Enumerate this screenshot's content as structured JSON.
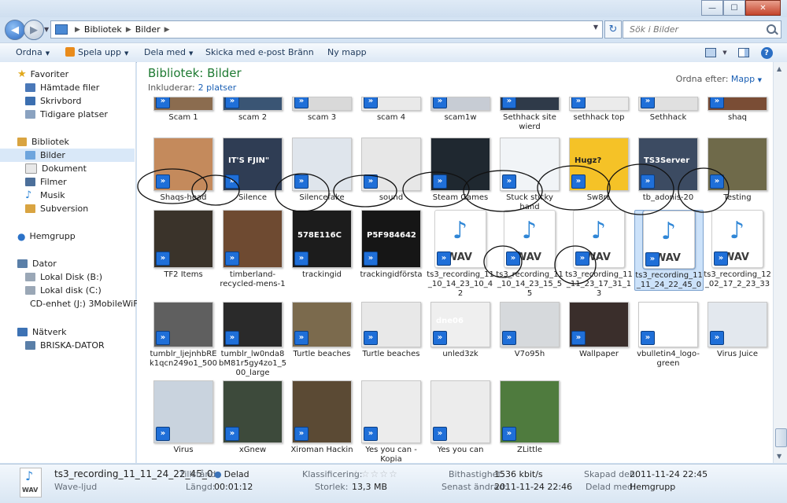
{
  "window": {
    "minimize": "—",
    "maximize": "☐",
    "close": "✕"
  },
  "address": {
    "crumbs": [
      "Bibliotek",
      "Bilder"
    ],
    "search_placeholder": "Sök i Bilder"
  },
  "toolbar": {
    "organize": "Ordna",
    "play": "Spela upp",
    "share": "Dela med",
    "email": "Skicka med e-post",
    "burn": "Bränn",
    "new_folder": "Ny mapp",
    "help": "?"
  },
  "sidebar": {
    "favorites": "Favoriter",
    "fav_items": [
      "Hämtade filer",
      "Skrivbord",
      "Tidigare platser"
    ],
    "libraries": "Bibliotek",
    "lib_items": [
      "Bilder",
      "Dokument",
      "Filmer",
      "Musik",
      "Subversion"
    ],
    "homegroup": "Hemgrupp",
    "computer": "Dator",
    "comp_items": [
      "Lokal Disk (B:)",
      "Lokal disk (C:)",
      "CD-enhet (J:) 3MobileWiFi"
    ],
    "network": "Nätverk",
    "net_items": [
      "BRISKA-DATOR"
    ]
  },
  "library": {
    "title": "Bibliotek: Bilder",
    "includes_label": "Inkluderar:",
    "includes_link": "2 platser",
    "sort_label": "Ordna efter:",
    "sort_value": "Mapp"
  },
  "files": [
    {
      "name": "Scam 1"
    },
    {
      "name": "scam 2"
    },
    {
      "name": "scam 3"
    },
    {
      "name": "scam 4"
    },
    {
      "name": "scam1w"
    },
    {
      "name": "Sethhack site wierd"
    },
    {
      "name": "sethhack top"
    },
    {
      "name": "Sethhack"
    },
    {
      "name": "shaq"
    },
    {
      "name": "Shaqs-head"
    },
    {
      "name": "Silence",
      "thumb_text": "IT'S FJIN\""
    },
    {
      "name": "Silencefake"
    },
    {
      "name": "sound"
    },
    {
      "name": "Steam Games"
    },
    {
      "name": "Stuck sticky hand"
    },
    {
      "name": "Sw8rL",
      "thumb_text": "Hugz?"
    },
    {
      "name": "tb_adonis-20",
      "thumb_text": "TS3Server"
    },
    {
      "name": "Testing"
    },
    {
      "name": "TF2 Items"
    },
    {
      "name": "timberland-recycled-mens-1"
    },
    {
      "name": "trackingid",
      "thumb_text": "578E116C"
    },
    {
      "name": "trackingidförsta",
      "thumb_text": "P5F984642"
    },
    {
      "name": "ts3_recording_11_10_14_23_10_42",
      "thumb_text": "WAV"
    },
    {
      "name": "ts3_recording_11_10_14_23_15_55",
      "thumb_text": "WAV"
    },
    {
      "name": "ts3_recording_11_11_23_17_31_13",
      "thumb_text": "WAV"
    },
    {
      "name": "ts3_recording_11_11_24_22_45_0",
      "thumb_text": "WAV"
    },
    {
      "name": "ts3_recording_12_02_17_2_23_33",
      "thumb_text": "WAV"
    },
    {
      "name": "tumblr_ljejnhbREk1qcn249o1_500"
    },
    {
      "name": "tumblr_lw0nda8bM81r5gy4zo1_500_large"
    },
    {
      "name": "Turtle beaches"
    },
    {
      "name": "Turtle beaches"
    },
    {
      "name": "unled3zk",
      "thumb_text": "dne06"
    },
    {
      "name": "V7o95h"
    },
    {
      "name": "Wallpaper"
    },
    {
      "name": "vbulletin4_logo-green"
    },
    {
      "name": "Virus Juice"
    },
    {
      "name": "Virus"
    },
    {
      "name": "xGnew"
    },
    {
      "name": "Xiroman Hackin"
    },
    {
      "name": "Yes you can - Kopia"
    },
    {
      "name": "Yes you can"
    },
    {
      "name": "ZLittle"
    }
  ],
  "details": {
    "filename": "ts3_recording_11_11_24_22_45_0",
    "type": "Wave-ljud",
    "icon_text": "WAV",
    "state_label": "Tillstånd:",
    "state_value": "Delad",
    "length_label": "Längd:",
    "length_value": "00:01:12",
    "rating_label": "Klassificering:",
    "rating": 0,
    "size_label": "Storlek:",
    "size_value": "13,3 MB",
    "bitrate_label": "Bithastighet:",
    "bitrate_value": "1536 kbit/s",
    "modified_label": "Senast ändrad:",
    "modified_value": "2011-11-24 22:46",
    "created_label": "Skapad den:",
    "created_value": "2011-11-24 22:45",
    "shared_label": "Delad med:",
    "shared_value": "Hemgrupp"
  },
  "colors": {
    "library_title": "#1e7a32",
    "link": "#1a5fb4",
    "overlay_icon": "#1f6fd8"
  }
}
